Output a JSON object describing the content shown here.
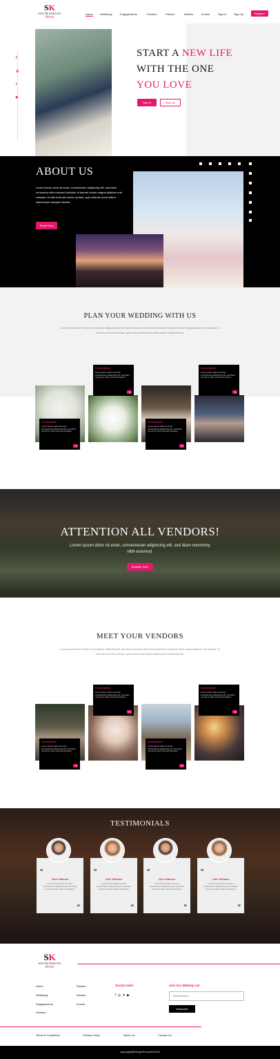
{
  "brand": {
    "mark_s": "S",
    "mark_k": "K",
    "name": "SOUTH DAKOTA",
    "tagline": "Weds"
  },
  "nav": {
    "items": [
      "Home",
      "Weddings",
      "Engagements",
      "Vendors",
      "Planner",
      "Articles",
      "Events",
      "Sign In",
      "Sign Up"
    ],
    "register": "Register"
  },
  "hero": {
    "line1a": "START A ",
    "line1b": "NEW LIFE",
    "line2": "WITH THE ONE",
    "line3": "YOU LOVE",
    "signin": "Sign In",
    "signup": "Sign Up"
  },
  "social": {
    "icons": [
      "facebook-icon",
      "instagram-icon",
      "twitter-icon",
      "youtube-icon"
    ],
    "glyphs": [
      "f",
      "◎",
      "t",
      "▶"
    ]
  },
  "about": {
    "title": "ABOUT US",
    "body": "Lorem ipsum dolor sit amet, consectetuer adipiscing elit, sed diam nonummy nibh euismod tincidunt ut laoreet dolore magna aliquam erat volutpat. Ut wisi enim ad minim veniam, quis nostrud exerci tation ullamcorper suscipit lobortis.",
    "button": "Read More"
  },
  "plan": {
    "title": "PLAN YOUR WEDDING WITH US",
    "body": "Lorem ipsum dolor sit amet, consectetuer adipiscing elit, sed diam nonummy nibh euismod tincidunt ut laoreet dolore magna aliquam erat volutpat. Ut wisi enim ad minim veniam, quis nostrud exerci tation ullamcorper suscipit lobortis.",
    "cards": [
      {
        "title": "Lorem Ipsum",
        "body": "Lorem ipsum dolor sit amet, consectetuer adipiscing elit, sed diam nonummy nibh euismod tincidunt."
      },
      {
        "title": "Lorem Ipsum",
        "body": "Lorem ipsum dolor sit amet, consectetuer adipiscing elit, sed diam nonummy nibh euismod tincidunt."
      },
      {
        "title": "Lorem Ipsum",
        "body": "Lorem ipsum dolor sit amet, consectetuer adipiscing elit, sed diam nonummy nibh euismod tincidunt."
      },
      {
        "title": "Lorem Ipsum",
        "body": "Lorem ipsum dolor sit amet, consectetuer adipiscing elit, sed diam nonummy nibh euismod tincidunt."
      }
    ]
  },
  "vendors_banner": {
    "title": "ATTENTION ALL VENDORS!",
    "body": "Lorem ipsum dolor sit amet, consectetuer adipiscing elit, sed diam nonummy nibh euismod.",
    "button": "Register Here"
  },
  "meet": {
    "title": "MEET YOUR VENDORS",
    "body": "Lorem ipsum dolor sit amet, consectetuer adipiscing elit, sed diam nonummy nibh euismod tincidunt ut laoreet dolore magna aliquam erat volutpat. Ut wisi enim ad minim veniam, quis nostrud exerci tation ullamcorper suscipit lobortis.",
    "cards": [
      {
        "title": "Lorem Ipsum",
        "body": "Lorem ipsum dolor sit amet, consectetuer adipiscing elit, sed diam nonummy nibh euismod tincidunt."
      },
      {
        "title": "Lorem Ipsum",
        "body": "Lorem ipsum dolor sit amet, consectetuer adipiscing elit, sed diam nonummy nibh euismod tincidunt."
      },
      {
        "title": "Lorem Ipsum",
        "body": "Lorem ipsum dolor sit amet, consectetuer adipiscing elit, sed diam nonummy nibh euismod tincidunt."
      },
      {
        "title": "Lorem Ipsum",
        "body": "Lorem ipsum dolor sit amet, consectetuer adipiscing elit, sed diam nonummy nibh euismod tincidunt."
      }
    ]
  },
  "testimonials": {
    "title": "TESTIMONIALS",
    "items": [
      {
        "name": "Jhon Watson",
        "text": "Lorem ipsum dolor sit amet, consectetuer adipiscing elit, sed diam nonummy nibh euismod tincidunt."
      },
      {
        "name": "Julie Willams",
        "text": "Lorem ipsum dolor sit amet, consectetuer adipiscing elit, sed diam nonummy nibh euismod tincidunt."
      },
      {
        "name": "Jhon Watson",
        "text": "Lorem ipsum dolor sit amet, consectetuer adipiscing elit, sed diam nonummy nibh euismod tincidunt."
      },
      {
        "name": "Julie Willams",
        "text": "Lorem ipsum dolor sit amet, consectetuer adipiscing elit, sed diam nonummy nibh euismod tincidunt."
      }
    ]
  },
  "footer": {
    "col1": [
      "Home",
      "Weddings",
      "Engagements",
      "Vendors"
    ],
    "col2": [
      "Planner",
      "Articles",
      "Events"
    ],
    "social_title": "Social Links",
    "social_glyphs": "f ◎ ✦ ▶",
    "mail_title": "Join Our Mailing List",
    "email_placeholder": "Email Address",
    "subscribe": "Subscribe",
    "bottom_links": [
      "Terms & Conditions",
      "Privacy Policy",
      "About Us",
      "Contact Us"
    ],
    "copyright": "copyright@DesignProsUSA2022"
  },
  "colors": {
    "accent": "#e5186e",
    "dark": "#000000",
    "light_gray": "#f2f2f2"
  }
}
